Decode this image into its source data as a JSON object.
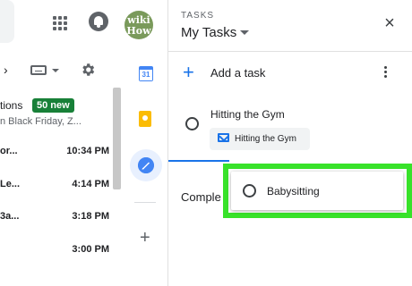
{
  "header": {
    "avatar_line1": "wiki",
    "avatar_line2": "How"
  },
  "toolbar": {
    "chevron": "›"
  },
  "promotions": {
    "label": "tions",
    "badge": "50 new",
    "subtitle": "n Black Friday, Z..."
  },
  "mail_rows": [
    {
      "sender": "or...",
      "time": "10:34 PM"
    },
    {
      "sender": "Le...",
      "time": "4:14 PM"
    },
    {
      "sender": "3a...",
      "time": "3:18 PM"
    },
    {
      "sender": "",
      "time": "3:00 PM"
    }
  ],
  "side_strip": {
    "calendar_day": "31",
    "add_symbol": "+"
  },
  "tasks_panel": {
    "label": "TASKS",
    "title": "My Tasks",
    "close_symbol": "×",
    "add_task_label": "Add a task",
    "tasks": [
      {
        "title": "Hitting the Gym",
        "email_link": "Hitting the Gym"
      }
    ],
    "completed_label": "Comple",
    "dragged_task": {
      "title": "Babysitting"
    }
  },
  "colors": {
    "accent": "#1a73e8",
    "badge": "#188038",
    "highlight": "#38e22a"
  }
}
